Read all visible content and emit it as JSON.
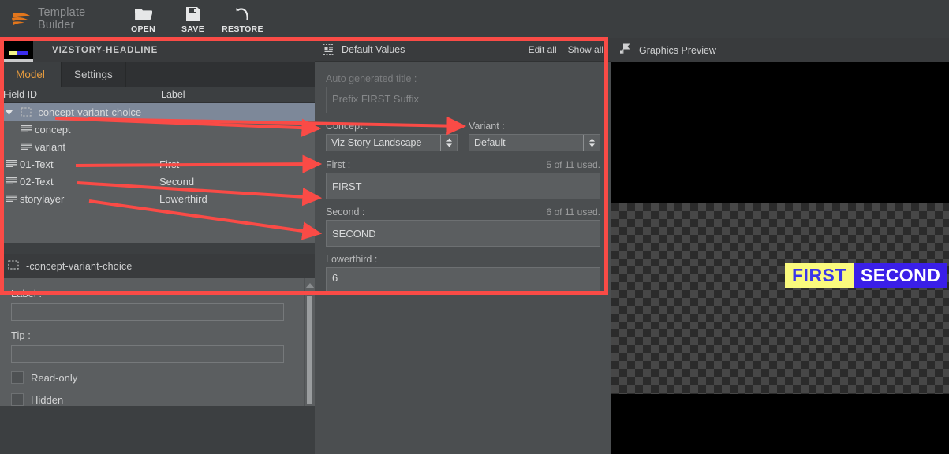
{
  "toolbar": {
    "brand": "Template Builder",
    "brand_logo_icon": "viz-flame-logo-icon",
    "buttons": [
      {
        "label": "OPEN",
        "icon": "folder-open-icon"
      },
      {
        "label": "SAVE",
        "icon": "floppy-disk-icon"
      },
      {
        "label": "RESTORE",
        "icon": "undo-arrow-icon"
      }
    ]
  },
  "left_panel": {
    "template_name": "VIZSTORY-HEADLINE",
    "thumbnail_icon": "template-thumbnail",
    "tabs": [
      {
        "label": "Model",
        "active": true
      },
      {
        "label": "Settings",
        "active": false
      }
    ],
    "tree_columns": [
      "Field ID",
      "Label"
    ],
    "tree_rows": [
      {
        "id": "-concept-variant-choice",
        "label": "",
        "icon": "dashed-box-icon",
        "indent": 0,
        "expanded": true,
        "selected": true
      },
      {
        "id": "concept",
        "label": "",
        "icon": "text-lines-icon",
        "indent": 2,
        "selected": false
      },
      {
        "id": "variant",
        "label": "",
        "icon": "text-lines-icon",
        "indent": 2,
        "selected": false
      },
      {
        "id": "01-Text",
        "label": "First",
        "icon": "text-lines-icon",
        "indent": 1,
        "selected": false
      },
      {
        "id": "02-Text",
        "label": "Second",
        "icon": "text-lines-icon",
        "indent": 1,
        "selected": false
      },
      {
        "id": "storylayer",
        "label": "Lowerthird",
        "icon": "text-lines-icon",
        "indent": 1,
        "selected": false
      }
    ]
  },
  "properties_panel": {
    "title": "-concept-variant-choice",
    "title_icon": "dashed-box-icon",
    "label_field": {
      "label": "Label :",
      "value": ""
    },
    "tip_field": {
      "label": "Tip :",
      "value": ""
    },
    "checkboxes": [
      {
        "label": "Read-only",
        "checked": false
      },
      {
        "label": "Hidden",
        "checked": false
      }
    ],
    "scrollbar_icon": "scroll-up-arrow-icon"
  },
  "default_values": {
    "title": "Default Values",
    "title_icon": "default-values-icon",
    "actions": [
      {
        "label": "Edit all"
      },
      {
        "label": "Show all"
      }
    ],
    "auto_title": {
      "label": "Auto generated title :",
      "value": "Prefix FIRST Suffix"
    },
    "concept": {
      "label": "Concept :",
      "value": "Viz Story Landscape",
      "dropdown_icon": "updown-spinner-icon"
    },
    "variant": {
      "label": "Variant :",
      "value": "Default",
      "dropdown_icon": "updown-spinner-icon"
    },
    "fields": [
      {
        "label": "First :",
        "value": "FIRST",
        "usage": "5 of 11 used."
      },
      {
        "label": "Second :",
        "value": "SECOND",
        "usage": "6 of 11 used."
      },
      {
        "label": "Lowerthird :",
        "value": "6",
        "usage": ""
      }
    ]
  },
  "graphics_preview": {
    "title": "Graphics Preview",
    "title_icon": "play-flag-icon",
    "graphic": {
      "first_text": "FIRST",
      "second_text": "SECOND",
      "first_bg": "#fafa7d",
      "first_fg": "#3a36e8",
      "second_bg": "#3a1fe8",
      "second_fg": "#ffffff"
    }
  },
  "annotations": {
    "highlight_color": "#fa4b46",
    "highlight_box": "model-and-default-values-region",
    "arrows": [
      {
        "from": "-concept-variant-choice",
        "to": "Concept :"
      },
      {
        "from": "-concept-variant-choice",
        "to": "Variant :"
      },
      {
        "from": "01-Text",
        "to": "First :"
      },
      {
        "from": "02-Text",
        "to": "Second :"
      },
      {
        "from": "storylayer",
        "to": "Lowerthird :"
      }
    ]
  }
}
